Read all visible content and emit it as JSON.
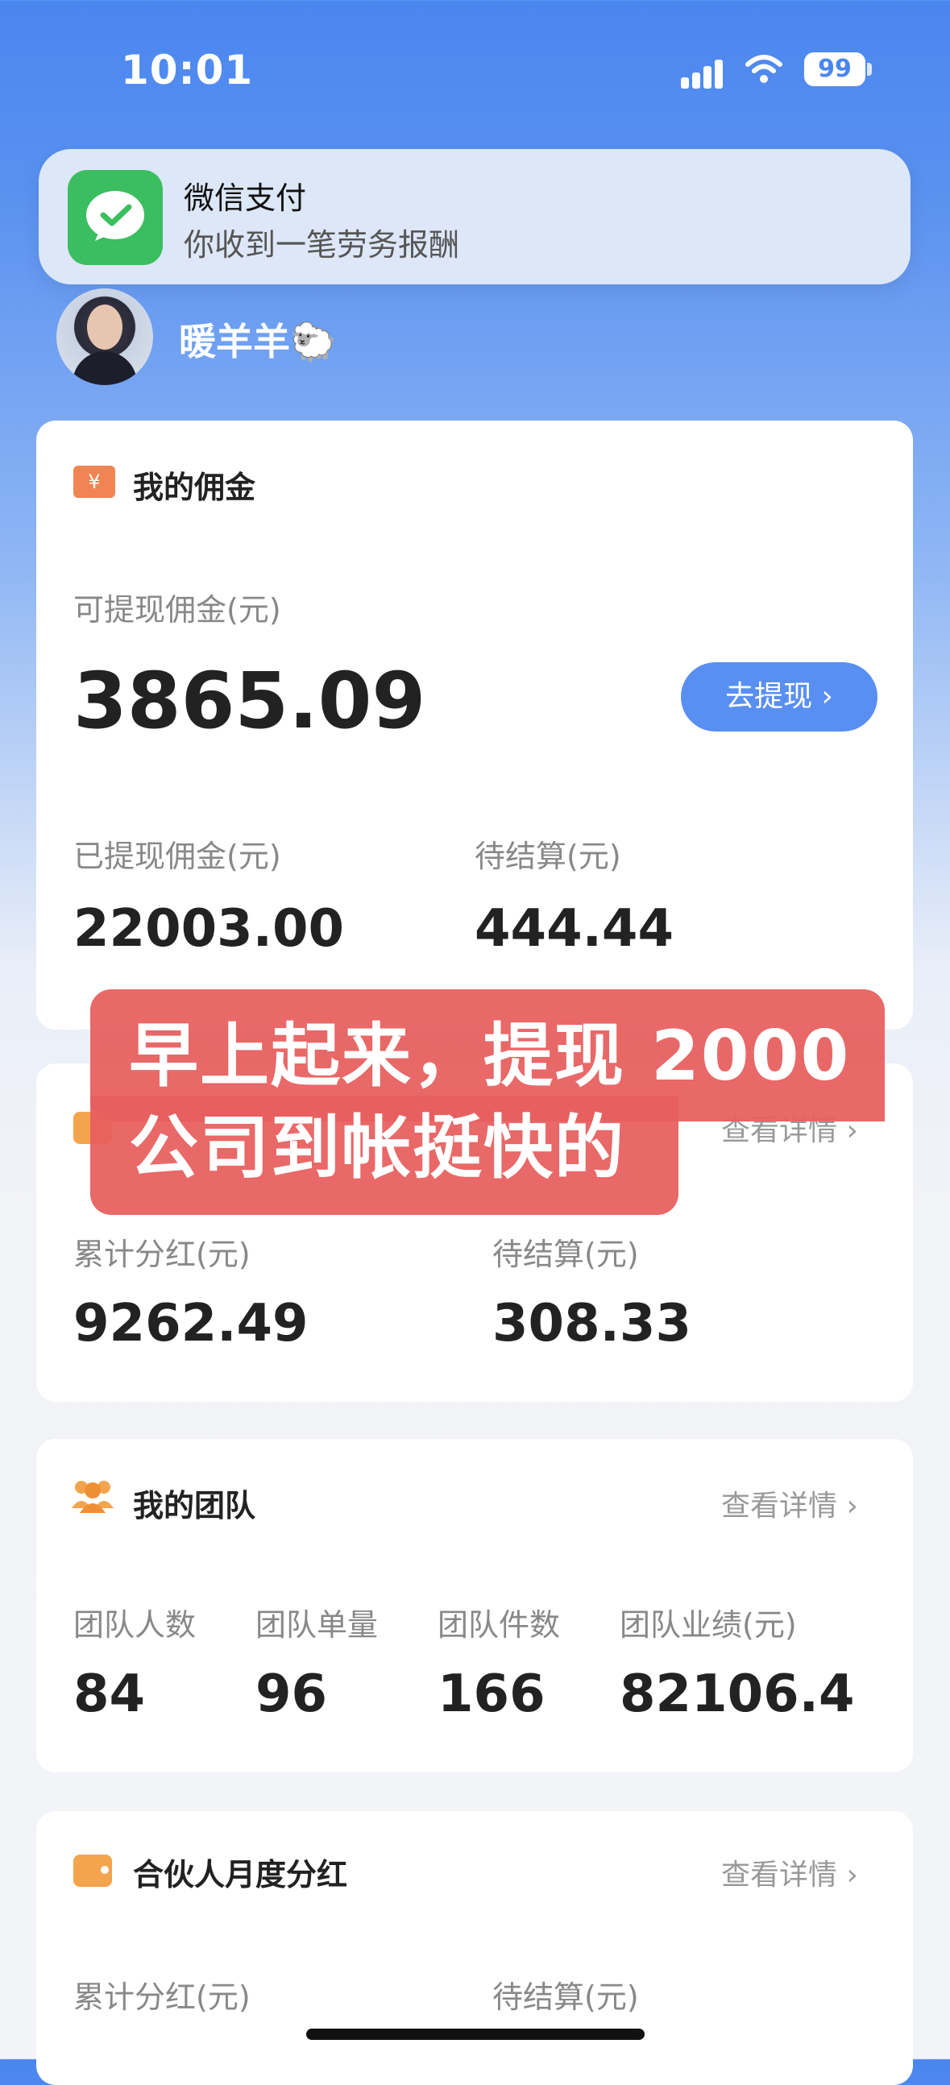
{
  "status": {
    "time": "10:01",
    "battery": "99"
  },
  "notification": {
    "app": "微信支付",
    "message": "你收到一笔劳务报酬",
    "icon": "wechat-pay-icon"
  },
  "profile": {
    "name": "暖羊羊🐑"
  },
  "commission": {
    "title": "我的佣金",
    "withdrawable_label": "可提现佣金(元)",
    "withdrawable_value": "3865.09",
    "withdraw_button": "去提现 ›",
    "withdrawn_label": "已提现佣金(元)",
    "withdrawn_value": "22003.00",
    "pending_label": "待结算(元)",
    "pending_value": "444.44"
  },
  "dividend_card": {
    "more": "查看详情 ›",
    "total_label": "累计分红(元)",
    "total_value": "9262.49",
    "pending_label": "待结算(元)",
    "pending_value": "308.33"
  },
  "team": {
    "title": "我的团队",
    "more": "查看详情 ›",
    "stats": [
      {
        "label": "团队人数",
        "value": "84"
      },
      {
        "label": "团队单量",
        "value": "96"
      },
      {
        "label": "团队件数",
        "value": "166"
      },
      {
        "label": "团队业绩(元)",
        "value": "82106.4"
      }
    ]
  },
  "monthly": {
    "title": "合伙人月度分红",
    "more": "查看详情 ›",
    "total_label": "累计分红(元)",
    "pending_label": "待结算(元)"
  },
  "overlay": {
    "line1": "早上起来，提现 2000",
    "line2": "公司到帐挺快的"
  },
  "colors": {
    "accent": "#5a8ff2",
    "overlay": "#e85f5f",
    "wechat_green": "#3bbe5f"
  }
}
